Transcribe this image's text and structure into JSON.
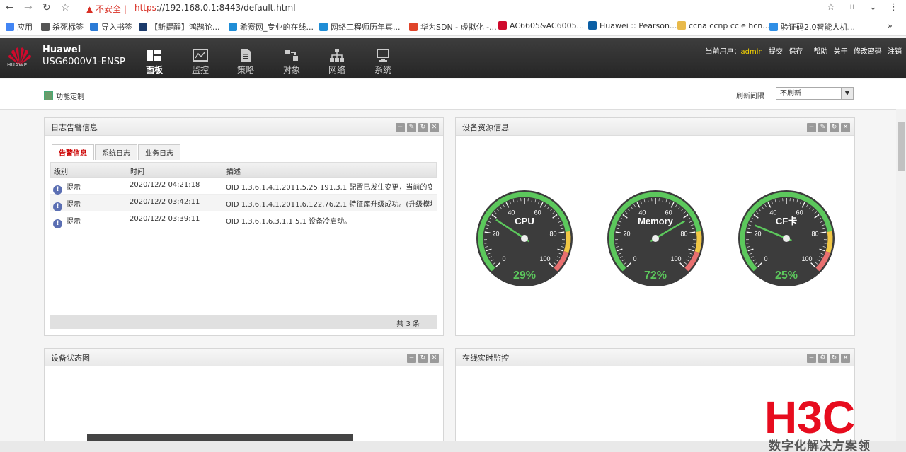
{
  "browser": {
    "security_text": "不安全",
    "url_scheme": "https",
    "url_rest": "://192.168.0.1:8443/default.html",
    "bookmarks": [
      {
        "label": "应用",
        "icon": "apps-grid-icon",
        "color": "#4285f4"
      },
      {
        "label": "杀死标签",
        "icon": "gear-icon",
        "color": "#555555"
      },
      {
        "label": "导入书签",
        "icon": "import-icon",
        "color": "#2b7bd6"
      },
      {
        "label": "【新提醒】鸿鹄论...",
        "icon": "hh-icon",
        "color": "#1b3a6b"
      },
      {
        "label": "希赛网_专业的在线...",
        "icon": "ie-icon",
        "color": "#1f8dd6"
      },
      {
        "label": "网络工程师历年真...",
        "icon": "ie-icon",
        "color": "#1f8dd6"
      },
      {
        "label": "华为SDN - 虚拟化 -...",
        "icon": "z-icon",
        "color": "#e0442a"
      },
      {
        "label": "AC6605&AC6005...",
        "icon": "huawei-icon",
        "color": "#cf0a2c"
      },
      {
        "label": "Huawei :: Pearson...",
        "icon": "pearson-icon",
        "color": "#0b5fa5"
      },
      {
        "label": "ccna ccnp ccie hcn...",
        "icon": "folder-icon",
        "color": "#e8b94a"
      },
      {
        "label": "验证码2.0智能人机...",
        "icon": "shield-icon",
        "color": "#2f8fe6"
      }
    ],
    "more": "»"
  },
  "header": {
    "brand_name": "Huawei",
    "model": "USG6000V1-ENSP",
    "logo_text": "HUAWEI",
    "nav": [
      {
        "label": "面板",
        "icon": "dashboard-icon"
      },
      {
        "label": "监控",
        "icon": "monitor-icon"
      },
      {
        "label": "策略",
        "icon": "policy-icon"
      },
      {
        "label": "对象",
        "icon": "object-icon"
      },
      {
        "label": "网络",
        "icon": "network-icon"
      },
      {
        "label": "系统",
        "icon": "system-icon"
      }
    ],
    "current_user_label": "当前用户：",
    "current_user": "admin",
    "actions": [
      "提交",
      "保存",
      "帮助",
      "关于",
      "修改密码",
      "注销"
    ]
  },
  "toolbar": {
    "custom_label": "功能定制",
    "refresh_label": "刷新间隔",
    "refresh_value": "不刷新"
  },
  "log_panel": {
    "title": "日志告警信息",
    "tabs": [
      "告警信息",
      "系统日志",
      "业务日志"
    ],
    "columns": [
      "级别",
      "时间",
      "描述"
    ],
    "rows": [
      {
        "level": "提示",
        "time": "2020/12/2 04:21:18",
        "desc": "OID 1.3.6.1.4.1.2011.5.25.191.3.1 配置已发生变更，当前的变..."
      },
      {
        "level": "提示",
        "time": "2020/12/2 03:42:11",
        "desc": "OID 1.3.6.1.4.1.2011.6.122.76.2.1 特征库升级成功。(升级模块..."
      },
      {
        "level": "提示",
        "time": "2020/12/2 03:39:11",
        "desc": "OID 1.3.6.1.6.3.1.1.5.1 设备冷启动。"
      }
    ],
    "footer": "共 3 条"
  },
  "resource_panel": {
    "title": "设备资源信息",
    "gauges": [
      {
        "label": "CPU",
        "value": 29,
        "display": "29%"
      },
      {
        "label": "Memory",
        "value": 72,
        "display": "72%"
      },
      {
        "label": "CF卡",
        "value": 25,
        "display": "25%"
      }
    ],
    "ticks": [
      "0",
      "20",
      "40",
      "60",
      "80",
      "100"
    ]
  },
  "status_panel": {
    "title": "设备状态图"
  },
  "monitor_panel": {
    "title": "在线实时监控"
  },
  "watermark": {
    "brand": "H3C",
    "slogan": "数字化解决方案领"
  },
  "colors": {
    "gauge_green": "#5cc85c",
    "gauge_yellow": "#f2c744",
    "gauge_red": "#e97070",
    "alert_red": "#c00000"
  }
}
